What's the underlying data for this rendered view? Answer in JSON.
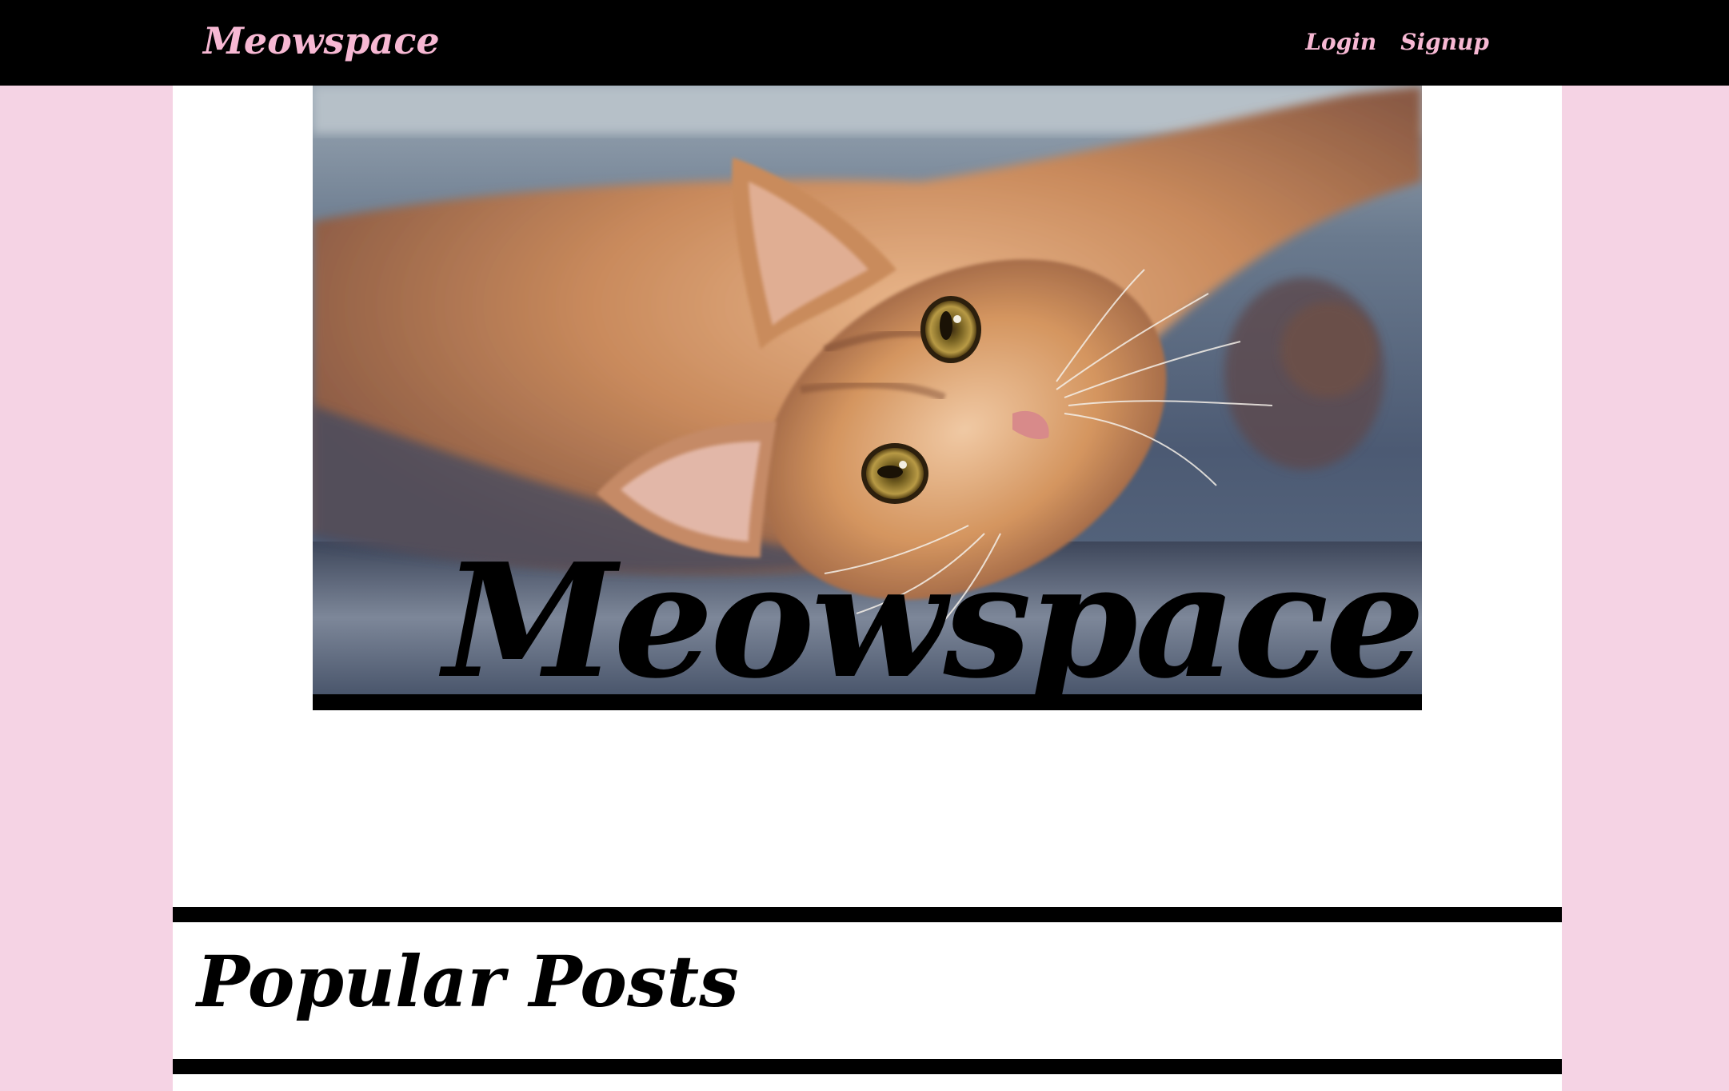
{
  "navbar": {
    "brand": "Meowspace",
    "links": [
      {
        "label": "Login"
      },
      {
        "label": "Signup"
      }
    ]
  },
  "hero": {
    "image_alt_semantic": "cat-photo",
    "title": "Meowspace"
  },
  "section": {
    "title": "Popular Posts"
  },
  "colors": {
    "page_background": "#f5d3e4",
    "navbar_background": "#000000",
    "nav_text": "#f7b8d3",
    "content_background": "#ffffff",
    "rule": "#000000"
  }
}
